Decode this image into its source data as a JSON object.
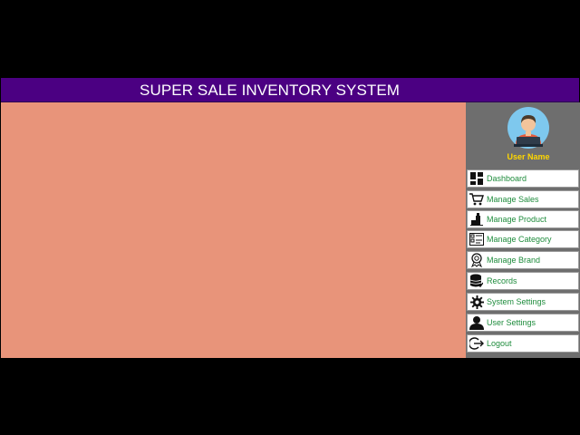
{
  "app": {
    "title": "SUPER SALE INVENTORY SYSTEM"
  },
  "profile": {
    "user_name": "User Name"
  },
  "menu": [
    {
      "label": "Dashboard",
      "icon": "dashboard-icon"
    },
    {
      "label": "Manage Sales",
      "icon": "cart-icon"
    },
    {
      "label": "Manage Product",
      "icon": "product-icon"
    },
    {
      "label": "Manage Category",
      "icon": "category-icon"
    },
    {
      "label": "Manage Brand",
      "icon": "brand-icon"
    },
    {
      "label": "Records",
      "icon": "database-icon"
    },
    {
      "label": "System Settings",
      "icon": "gear-icon"
    },
    {
      "label": "User Settings",
      "icon": "user-icon"
    },
    {
      "label": "Logout",
      "icon": "logout-icon"
    }
  ],
  "colors": {
    "titlebar": "#4b0082",
    "main_background": "#e8947a",
    "sidebar_background": "#6e6e6e",
    "menu_text": "#1e8c3c",
    "username_text": "#ffd700"
  }
}
